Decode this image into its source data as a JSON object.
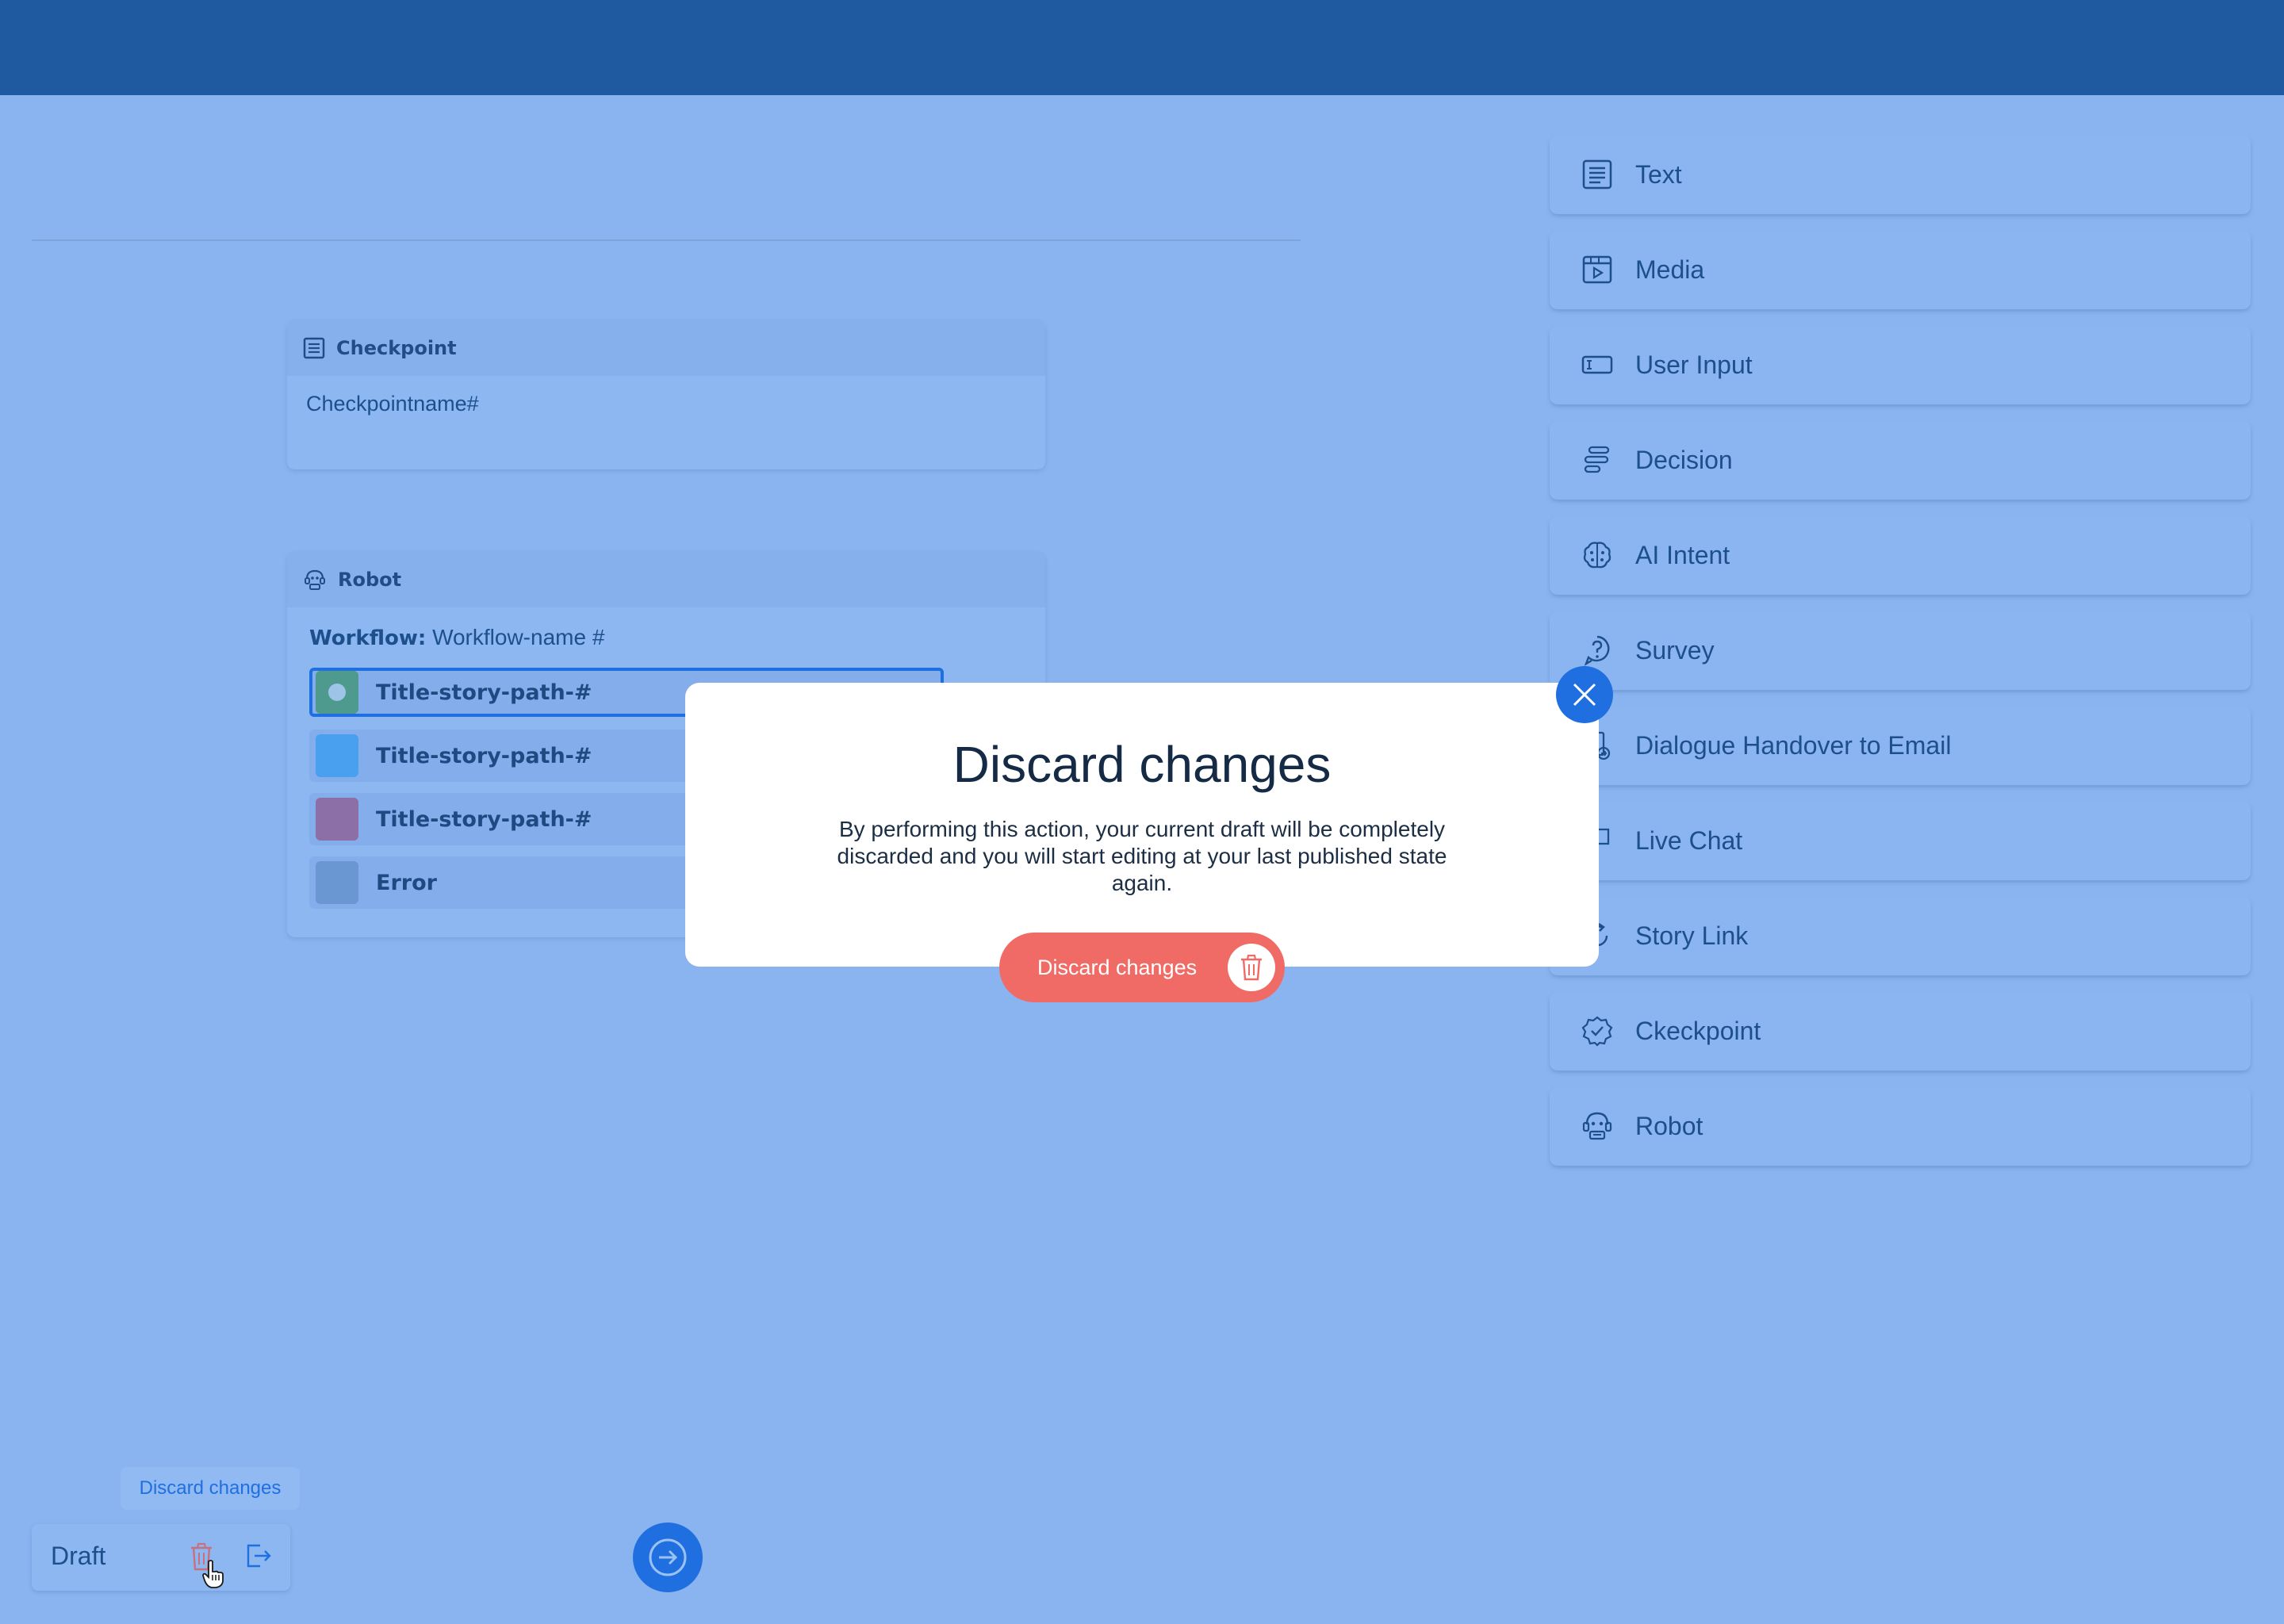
{
  "canvas": {
    "checkpoint_card": {
      "header": "Checkpoint",
      "name": "Checkpointname#"
    },
    "robot_card": {
      "header": "Robot",
      "workflow_label": "Workflow:",
      "workflow_value": "Workflow-name #",
      "paths": [
        {
          "label": "Title-story-path-#",
          "color": "#4e9a8e",
          "selected": true
        },
        {
          "label": "Title-story-path-#",
          "color": "#48a0ee",
          "selected": false
        },
        {
          "label": "Title-story-path-#",
          "color": "#8d6fa8",
          "selected": false
        },
        {
          "label": "Error",
          "color": "#6a97d2",
          "selected": false
        }
      ]
    }
  },
  "palette": {
    "items": [
      {
        "label": "Text",
        "icon": "text-icon"
      },
      {
        "label": "Media",
        "icon": "media-icon"
      },
      {
        "label": "User Input",
        "icon": "user-input-icon"
      },
      {
        "label": "Decision",
        "icon": "decision-icon"
      },
      {
        "label": "AI Intent",
        "icon": "ai-intent-icon"
      },
      {
        "label": "Survey",
        "icon": "survey-icon"
      },
      {
        "label": "Dialogue Handover to Email",
        "icon": "email-handover-icon"
      },
      {
        "label": "Live Chat",
        "icon": "live-chat-icon"
      },
      {
        "label": "Story Link",
        "icon": "story-link-icon"
      },
      {
        "label": "Ckeckpoint",
        "icon": "checkpoint-badge-icon"
      },
      {
        "label": "Robot",
        "icon": "robot-icon"
      }
    ]
  },
  "footer": {
    "tooltip": "Discard changes",
    "draft_label": "Draft"
  },
  "modal": {
    "title": "Discard changes",
    "body": "By performing this action, your current draft will be completely discarded and you will start editing at your last published state again.",
    "button_label": "Discard changes"
  },
  "colors": {
    "topbar": "#1f5aa1",
    "backdrop": "#8ab4f0",
    "accent": "#1f6fe0",
    "danger": "#f06a66"
  }
}
